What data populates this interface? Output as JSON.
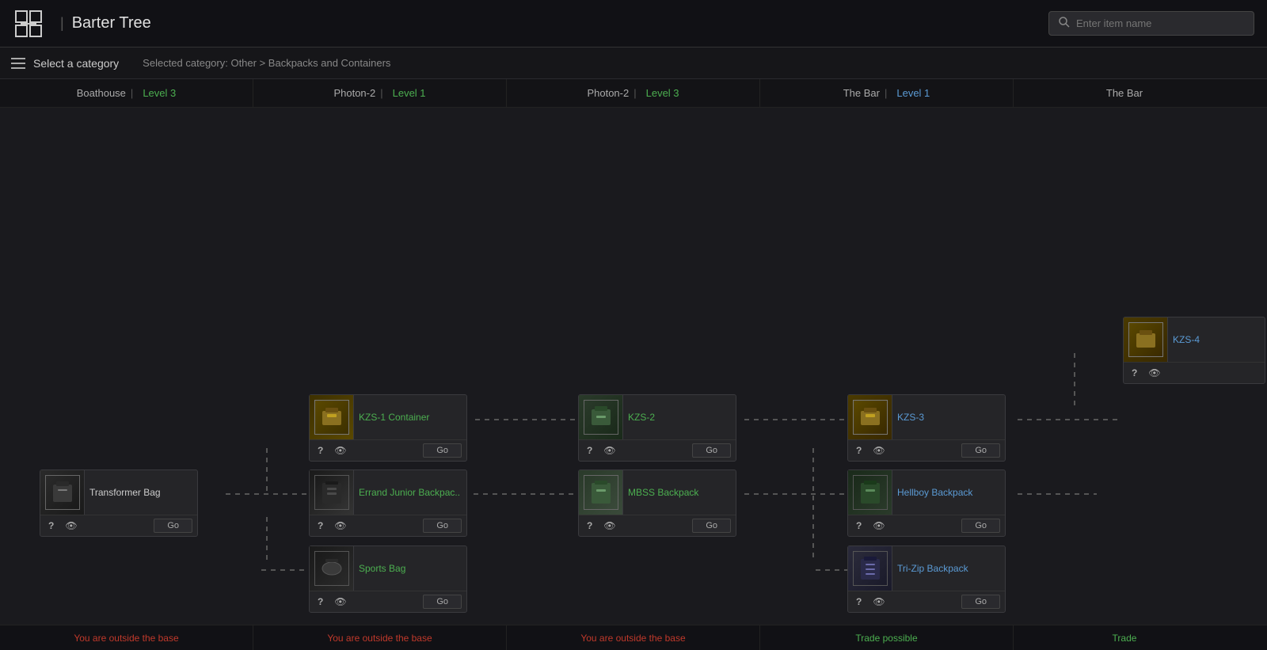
{
  "header": {
    "logo_alt": "Barter Tree Logo",
    "title": "Barter Tree",
    "search_placeholder": "Enter item name"
  },
  "nav": {
    "category_label": "Select a category",
    "selected_category": "Selected category: Other > Backpacks and Containers"
  },
  "columns": [
    {
      "id": "boathouse",
      "name": "Boathouse",
      "level": "Level 3",
      "level_color": "green"
    },
    {
      "id": "photon2-l1",
      "name": "Photon-2",
      "level": "Level 1",
      "level_color": "green"
    },
    {
      "id": "photon2-l3",
      "name": "Photon-2",
      "level": "Level 3",
      "level_color": "green"
    },
    {
      "id": "thebar-l1",
      "name": "The Bar",
      "level": "Level 1",
      "level_color": "blue"
    },
    {
      "id": "thebar-l2",
      "name": "The Bar",
      "level_color": "blue"
    }
  ],
  "items": [
    {
      "id": "kzs1",
      "name": "KZS-1 Container",
      "name_color": "green",
      "thumb": "kzs1",
      "col": 1,
      "row": 1,
      "go_label": "Go"
    },
    {
      "id": "kzs2",
      "name": "KZS-2",
      "name_color": "green",
      "thumb": "kzs2",
      "col": 2,
      "row": 1,
      "go_label": "Go"
    },
    {
      "id": "kzs3",
      "name": "KZS-3",
      "name_color": "blue",
      "thumb": "kzs3",
      "col": 3,
      "row": 1,
      "go_label": "Go"
    },
    {
      "id": "kzs4",
      "name": "KZS-4",
      "name_color": "blue",
      "thumb": "kzs4",
      "col": 4,
      "row": 0,
      "go_label": ""
    },
    {
      "id": "transformer",
      "name": "Transformer Bag",
      "name_color": "white",
      "thumb": "transformer",
      "col": 0,
      "row": 2,
      "go_label": "Go"
    },
    {
      "id": "errand",
      "name": "Errand Junior Backpac..",
      "name_color": "green",
      "thumb": "errand",
      "col": 1,
      "row": 2,
      "go_label": "Go"
    },
    {
      "id": "mbss",
      "name": "MBSS Backpack",
      "name_color": "green",
      "thumb": "mbss",
      "col": 2,
      "row": 2,
      "go_label": "Go"
    },
    {
      "id": "hellboy",
      "name": "Hellboy Backpack",
      "name_color": "blue",
      "thumb": "hellboy",
      "col": 3,
      "row": 2,
      "go_label": "Go"
    },
    {
      "id": "sports",
      "name": "Sports Bag",
      "name_color": "green",
      "thumb": "sports",
      "col": 1,
      "row": 3,
      "go_label": "Go"
    },
    {
      "id": "trizip",
      "name": "Tri-Zip Backpack",
      "name_color": "blue",
      "thumb": "trizip",
      "col": 3,
      "row": 3,
      "go_label": "Go"
    }
  ],
  "footer": [
    {
      "id": "f1",
      "text": "You are outside the base",
      "color": "outside"
    },
    {
      "id": "f2",
      "text": "You are outside the base",
      "color": "outside"
    },
    {
      "id": "f3",
      "text": "You are outside the base",
      "color": "outside"
    },
    {
      "id": "f4",
      "text": "Trade possible",
      "color": "trade"
    },
    {
      "id": "f5",
      "text": "Trade",
      "color": "trade"
    }
  ],
  "buttons": {
    "go": "Go",
    "question": "?",
    "hamburger": "☰"
  }
}
